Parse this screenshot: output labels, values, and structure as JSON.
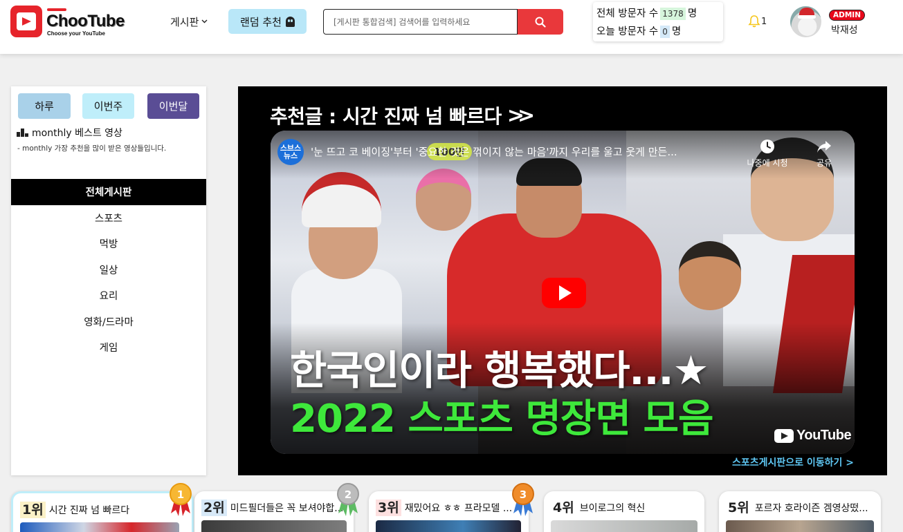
{
  "header": {
    "logo": {
      "title": "ChooTube",
      "subtitle": "Choose your YouTube"
    },
    "nav_board": "게시판",
    "random_button": "랜덤 추천",
    "search": {
      "placeholder": "[게시판 통합검색] 검색어를 입력하세요",
      "value": ""
    },
    "visitors": {
      "total_label": "전체 방문자 수",
      "total_value": "1378",
      "today_label": "오늘 방문자 수",
      "today_value": "0",
      "unit": "명"
    },
    "notifications": "1",
    "user": {
      "badge": "ADMIN",
      "name": "박재성"
    }
  },
  "sidebar": {
    "periods": [
      "하루",
      "이번주",
      "이번달"
    ],
    "best_title": "monthly 베스트 영상",
    "best_desc": "- monthly 가장 추천을 많이 받은 영상들입니다.",
    "menu": [
      "전체게시판",
      "스포츠",
      "먹방",
      "일상",
      "요리",
      "영화/드라마",
      "게임"
    ]
  },
  "feature": {
    "title": "추천글 : 시간 진짜 넘 빠르다",
    "chevrons": ">>",
    "video": {
      "channel": "스브스 뉴스",
      "title": "'눈 뜨고 코 베이징'부터 '중요한 것은 꺾이지 않는 마음'까지 우리를 울고 웃게 만든...",
      "watch_later": "나중에 시청",
      "share": "공유",
      "stamp": "100만",
      "headline": "한국인이라 행복했다...★",
      "subheadline": "2022 스포츠 명장면 모음",
      "brand": "YouTube"
    },
    "link": "스포츠게시판으로 이동하기 >"
  },
  "ranking": [
    {
      "rank": "1위",
      "title": "시간 진짜 넘 빠르다",
      "rank_bg": "#fbf1c7",
      "medal": "1"
    },
    {
      "rank": "2위",
      "title": "미드필더들은 꼭 보셔야합...",
      "rank_bg": "#d7e9f8",
      "medal": "2"
    },
    {
      "rank": "3위",
      "title": "재밌어요 ㅎㅎ 프라모델 ...",
      "rank_bg": "#fde0e0",
      "medal": "3"
    },
    {
      "rank": "4위",
      "title": "브이로그의 혁신",
      "rank_bg": "#ffffff",
      "medal": ""
    },
    {
      "rank": "5위",
      "title": "포르자 호라이즌 겜영상떴...",
      "rank_bg": "#ffffff",
      "medal": ""
    }
  ],
  "colors": {
    "accent_red": "#e6242b",
    "search_red": "#e9383b",
    "period_month": "#5a4d95",
    "link_blue": "#5ec6f2",
    "headline_green": "#3ee83b"
  }
}
